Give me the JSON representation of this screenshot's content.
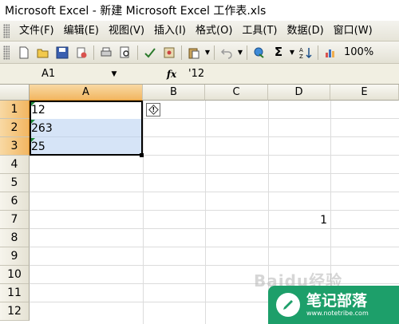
{
  "window": {
    "title": "Microsoft Excel - 新建 Microsoft Excel 工作表.xls"
  },
  "menu": {
    "items": [
      "文件(F)",
      "编辑(E)",
      "视图(V)",
      "插入(I)",
      "格式(O)",
      "工具(T)",
      "数据(D)",
      "窗口(W)"
    ]
  },
  "toolbar": {
    "icons": [
      "new-icon",
      "open-icon",
      "save-icon",
      "permission-icon",
      "print-icon",
      "print-preview-icon",
      "spelling-icon",
      "research-icon",
      "paste-icon",
      "undo-icon",
      "hyperlink-icon",
      "autosum-icon",
      "sort-ascending-icon",
      "chart-wizard-icon"
    ],
    "autosum_symbol": "Σ",
    "zoom": "100%"
  },
  "formula_bar": {
    "name_box": "A1",
    "fx_label": "fx",
    "content": "'12"
  },
  "columns": [
    "A",
    "B",
    "C",
    "D",
    "E"
  ],
  "rows": [
    "1",
    "2",
    "3",
    "4",
    "5",
    "6",
    "7",
    "8",
    "9",
    "10",
    "11",
    "12"
  ],
  "cells": {
    "A1": "12",
    "A2": "263",
    "A3": "25",
    "D7": "1"
  },
  "selection": {
    "range": "A1:A3",
    "active": "A1"
  },
  "watermark": {
    "baidu": "Baidu经验",
    "brand": "笔记部落",
    "brand_url": "www.notetribe.com"
  },
  "colors": {
    "header_selected": "#f2b661",
    "selection_fill": "#b4cdf0",
    "error_indicator": "#1f8a3a",
    "brand_green": "#1d9f6a"
  }
}
